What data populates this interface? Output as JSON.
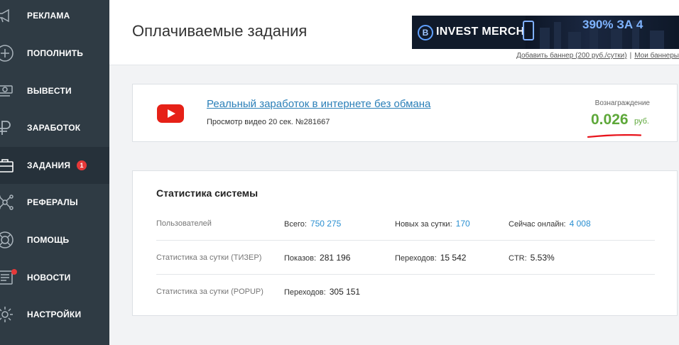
{
  "sidebar": {
    "items": [
      {
        "label": "РЕКЛАМА",
        "icon": "megaphone-icon"
      },
      {
        "label": "ПОПОЛНИТЬ",
        "icon": "plus-circle-icon"
      },
      {
        "label": "ВЫВЕСТИ",
        "icon": "cash-withdraw-icon"
      },
      {
        "label": "ЗАРАБОТОК",
        "icon": "ruble-icon"
      },
      {
        "label": "ЗАДАНИЯ",
        "icon": "briefcase-icon",
        "badge": "1"
      },
      {
        "label": "РЕФЕРАЛЫ",
        "icon": "network-icon"
      },
      {
        "label": "ПОМОЩЬ",
        "icon": "lifebuoy-icon"
      },
      {
        "label": "НОВОСТИ",
        "icon": "newspaper-icon"
      },
      {
        "label": "НАСТРОЙКИ",
        "icon": "gear-icon"
      }
    ],
    "active_index": 4
  },
  "header": {
    "title": "Оплачиваемые задания",
    "banner": {
      "brand": "INVEST MERCH",
      "promo": "390% ЗА 4"
    },
    "links": {
      "add_banner": "Добавить баннер (200 руб./сутки)",
      "separator": "|",
      "my_banners": "Мои баннеры"
    }
  },
  "task": {
    "icon": "youtube-icon",
    "title": "Реальный заработок в интернете без обмана",
    "subtitle": "Просмотр видео 20 сек. №281667",
    "reward_label": "Вознаграждение",
    "reward_value": "0.026",
    "reward_unit": "руб."
  },
  "stats": {
    "title": "Статистика системы",
    "rows": [
      {
        "label": "Пользователей",
        "cells": [
          {
            "label": "Всего:",
            "value": "750 275"
          },
          {
            "label": "Новых за сутки:",
            "value": "170"
          },
          {
            "label": "Сейчас онлайн:",
            "value": "4 008"
          }
        ]
      },
      {
        "label": "Статистика за сутки (ТИЗЕР)",
        "cells": [
          {
            "label": "Показов:",
            "value": "281 196"
          },
          {
            "label": "Переходов:",
            "value": "15 542"
          },
          {
            "label": "CTR:",
            "value": "5.53%"
          }
        ]
      },
      {
        "label": "Статистика за сутки (POPUP)",
        "cells": [
          {
            "label": "Переходов:",
            "value": "305 151"
          }
        ]
      }
    ]
  },
  "colors": {
    "sidebar_bg": "#2f3b44",
    "accent_blue": "#2a8fd1",
    "reward_green": "#5ea83a",
    "badge_red": "#e63939"
  }
}
